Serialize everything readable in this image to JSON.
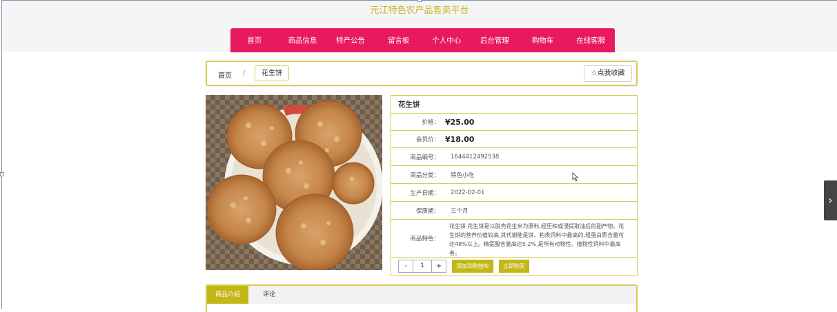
{
  "header": {
    "site_title": "元江特色农产品售卖平台",
    "nav": [
      "首页",
      "商品信息",
      "特产公告",
      "留言板",
      "个人中心",
      "后台管理",
      "购物车",
      "在线客服"
    ]
  },
  "breadcrumb": {
    "home": "首页",
    "separator": "/",
    "current": "花生饼",
    "favorite_button": "☆点我收藏"
  },
  "product": {
    "name": "花生饼",
    "price_label": "价格：",
    "price": "¥25.00",
    "member_price_label": "会员价：",
    "member_price": "¥18.00",
    "fields": [
      {
        "label": "商品编号：",
        "value": "1644412492538"
      },
      {
        "label": "商品分类：",
        "value": "特色小吃"
      },
      {
        "label": "生产日期：",
        "value": "2022-02-01"
      },
      {
        "label": "保质期：",
        "value": "三个月"
      }
    ],
    "feature_label": "商品特色：",
    "feature_text": "花生饼 花生饼是以脱壳花生米为原料,经压榨或浸提取油后的副产物。花生饼的营养价值较高,其代谢能是饼、粕类饲料中最高的,粗蛋白质含量可达48%以上。精氨酸含量高达5.2%,是所有动物性、植物性饲料中最高者。",
    "quantity": "1",
    "minus": "-",
    "plus": "+",
    "add_to_cart": "添加到购物车",
    "buy_now": "立即购买"
  },
  "tabs": [
    "商品介绍",
    "评论"
  ],
  "colors": {
    "nav": "#e8195e",
    "accent": "#c2b716",
    "border": "#d4cd56",
    "title": "#c8b52a"
  }
}
